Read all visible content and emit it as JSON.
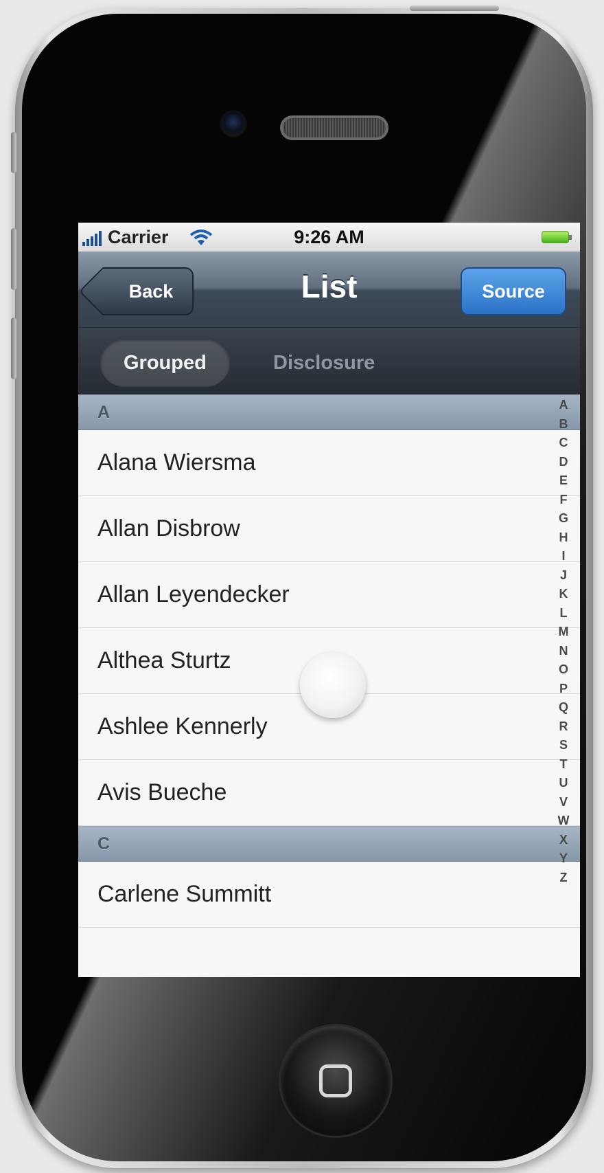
{
  "status_bar": {
    "carrier": "Carrier",
    "time": "9:26 AM"
  },
  "nav_bar": {
    "back_label": "Back",
    "title": "List",
    "source_label": "Source"
  },
  "tabs": [
    {
      "label": "Grouped",
      "active": true
    },
    {
      "label": "Disclosure",
      "active": false
    }
  ],
  "sections": [
    {
      "header": "A",
      "rows": [
        "Alana Wiersma",
        "Allan Disbrow",
        "Allan Leyendecker",
        "Althea Sturtz",
        "Ashlee Kennerly",
        "Avis Bueche"
      ]
    },
    {
      "header": "C",
      "rows": [
        "Carlene Summitt"
      ]
    }
  ],
  "index": [
    "A",
    "B",
    "C",
    "D",
    "E",
    "F",
    "G",
    "H",
    "I",
    "J",
    "K",
    "L",
    "M",
    "N",
    "O",
    "P",
    "Q",
    "R",
    "S",
    "T",
    "U",
    "V",
    "W",
    "X",
    "Y",
    "Z"
  ],
  "colors": {
    "accent": "#2a72c6",
    "section_header": "#8798aa",
    "nav_bar": "#4a5766"
  }
}
